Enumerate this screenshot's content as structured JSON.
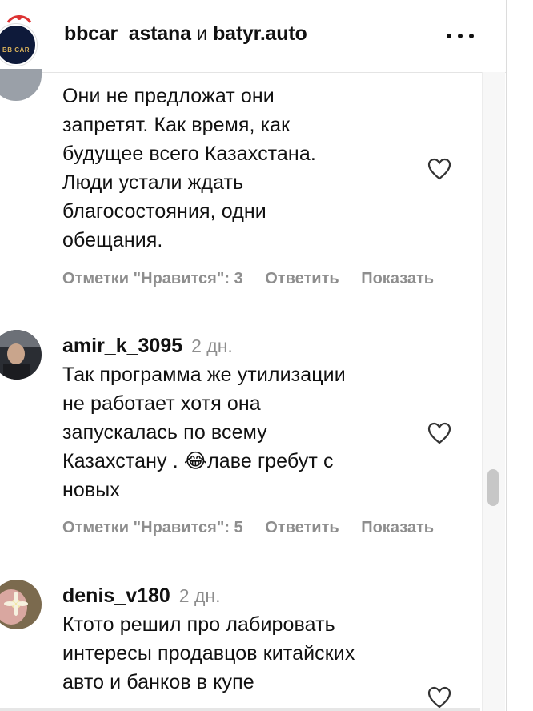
{
  "header": {
    "account_a": "bbcar_astana",
    "and_word": "и",
    "account_b": "batyr.auto",
    "logo_text": "BB CAR",
    "more_icon": "more-horizontal-icon"
  },
  "comments": [
    {
      "text_lines": [
        "Они не предложат они",
        "запретят. Как время, как",
        "будущее всего Казахстана.",
        "Люди устали ждать",
        "благосостояния, одни",
        "обещания."
      ],
      "likes": "Отметки \"Нравится\": 3",
      "reply": "Ответить",
      "show": "Показать"
    },
    {
      "username": "amir_k_3095",
      "time": "2 дн.",
      "text_lines": [
        "Так программа же утилизации",
        "не работает хотя она",
        "запускалась по всему",
        "Казахстану . 😂лаве гребут с",
        "новых"
      ],
      "likes": "Отметки \"Нравится\": 5",
      "reply": "Ответить",
      "show": "Показать"
    },
    {
      "username": "denis_v180",
      "time": "2 дн.",
      "text_lines": [
        "Ктото решил про лабировать",
        "интересы продавцов китайских",
        "авто и банков в купе"
      ]
    }
  ],
  "colors": {
    "muted": "#8e8e8e",
    "text": "#111111",
    "logo_bg": "#0e1a3a"
  }
}
